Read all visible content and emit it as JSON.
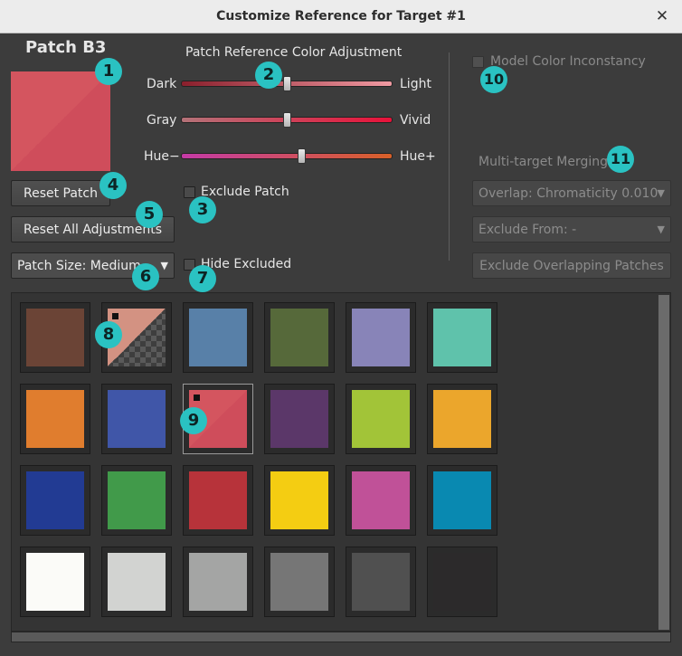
{
  "window": {
    "title": "Customize Reference for Target #1",
    "close_glyph": "✕"
  },
  "patch": {
    "name": "Patch B3",
    "preview_colors": [
      "#d4555f",
      "#cf4d5b"
    ]
  },
  "adjust": {
    "heading": "Patch Reference Color Adjustment",
    "sliders": [
      {
        "left": "Dark",
        "right": "Light",
        "value": 0.5,
        "gradient": [
          "#8a1f2c",
          "#f09aa2"
        ]
      },
      {
        "left": "Gray",
        "right": "Vivid",
        "value": 0.5,
        "gradient": [
          "#b47278",
          "#e8123a"
        ]
      },
      {
        "left": "Hue−",
        "right": "Hue+",
        "value": 0.57,
        "gradient": [
          "#c43aa6",
          "#d86028"
        ]
      }
    ]
  },
  "buttons": {
    "reset_patch": "Reset Patch",
    "reset_all": "Reset All Adjustments",
    "exclude_overlapping": "Exclude Overlapping Patches"
  },
  "checks": {
    "exclude_patch": "Exclude Patch",
    "hide_excluded": "Hide Excluded",
    "model_inconstancy": "Model Color Inconstancy"
  },
  "patch_size": {
    "label": "Patch Size: Medium",
    "arrow": "▼"
  },
  "merge": {
    "heading": "Multi-target Merging",
    "overlap": "Overlap: Chromaticity 0.010",
    "exclude_from": "Exclude From: -",
    "arrow": "▼"
  },
  "badges": [
    "1",
    "2",
    "3",
    "4",
    "5",
    "6",
    "7",
    "8",
    "9",
    "10",
    "11"
  ],
  "patches": [
    {
      "color": "#6b4436",
      "marked": false,
      "excluded": false
    },
    {
      "color": "#d39282",
      "marked": true,
      "excluded": true
    },
    {
      "color": "#5880a8",
      "marked": false,
      "excluded": false
    },
    {
      "color": "#56693a",
      "marked": false,
      "excluded": false
    },
    {
      "color": "#8884b8",
      "marked": false,
      "excluded": false
    },
    {
      "color": "#5fc2ab",
      "marked": false,
      "excluded": false
    },
    {
      "color": "#e07d2e",
      "marked": false,
      "excluded": false
    },
    {
      "color": "#4056a8",
      "marked": false,
      "excluded": false
    },
    {
      "color": "#d24e5e",
      "marked": true,
      "excluded": false,
      "selected": true
    },
    {
      "color": "#5b3769",
      "marked": false,
      "excluded": false
    },
    {
      "color": "#a2c438",
      "marked": false,
      "excluded": false
    },
    {
      "color": "#eba62c",
      "marked": false,
      "excluded": false
    },
    {
      "color": "#223b93",
      "marked": false,
      "excluded": false
    },
    {
      "color": "#419a4a",
      "marked": false,
      "excluded": false
    },
    {
      "color": "#b7333a",
      "marked": false,
      "excluded": false
    },
    {
      "color": "#f4cd12",
      "marked": false,
      "excluded": false
    },
    {
      "color": "#c05198",
      "marked": false,
      "excluded": false
    },
    {
      "color": "#0989b1",
      "marked": false,
      "excluded": false
    },
    {
      "color": "#fbfbf8",
      "marked": false,
      "excluded": false
    },
    {
      "color": "#d2d3d1",
      "marked": false,
      "excluded": false
    },
    {
      "color": "#a4a5a4",
      "marked": false,
      "excluded": false
    },
    {
      "color": "#767676",
      "marked": false,
      "excluded": false
    },
    {
      "color": "#505050",
      "marked": false,
      "excluded": false
    },
    {
      "color": "#2c2a2b",
      "marked": false,
      "excluded": false
    }
  ]
}
